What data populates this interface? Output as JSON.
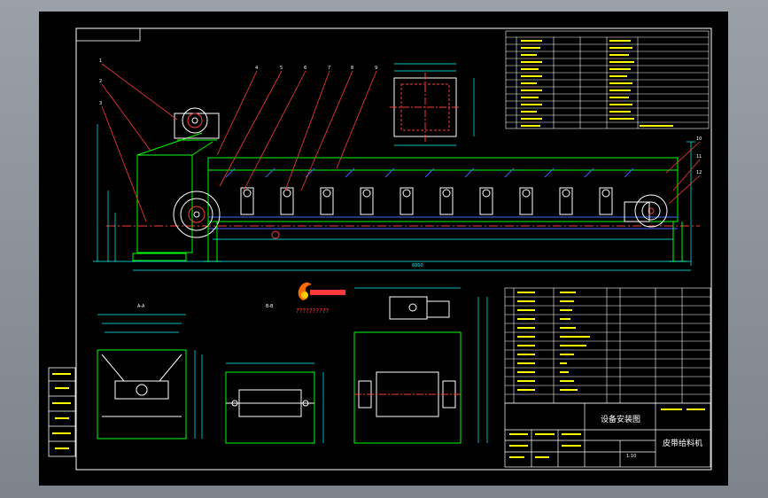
{
  "colors": {
    "background": "#000000",
    "frame": "#ffffff",
    "outline": "#00ff00",
    "dimension": "#00ffff",
    "leader": "#ff3a3a",
    "belt": "#3b6bff",
    "centerline": "#ff3a3a",
    "viewport": "#8c9096",
    "stamp": "#ffff00"
  },
  "title_block": {
    "drawing_title": "设备安装图",
    "product_name": "皮带给料机",
    "scale_value": "1:10"
  },
  "view_labels": {
    "section_a": "A-A",
    "section_b": "B-B"
  },
  "overall_dimension": "6000",
  "part_numbers": [
    "1",
    "2",
    "3",
    "4",
    "5",
    "6",
    "7",
    "8",
    "9",
    "10",
    "11",
    "12"
  ],
  "logo_caption": "??????????",
  "left_column_cells": [
    "",
    "",
    "",
    "",
    "",
    ""
  ]
}
